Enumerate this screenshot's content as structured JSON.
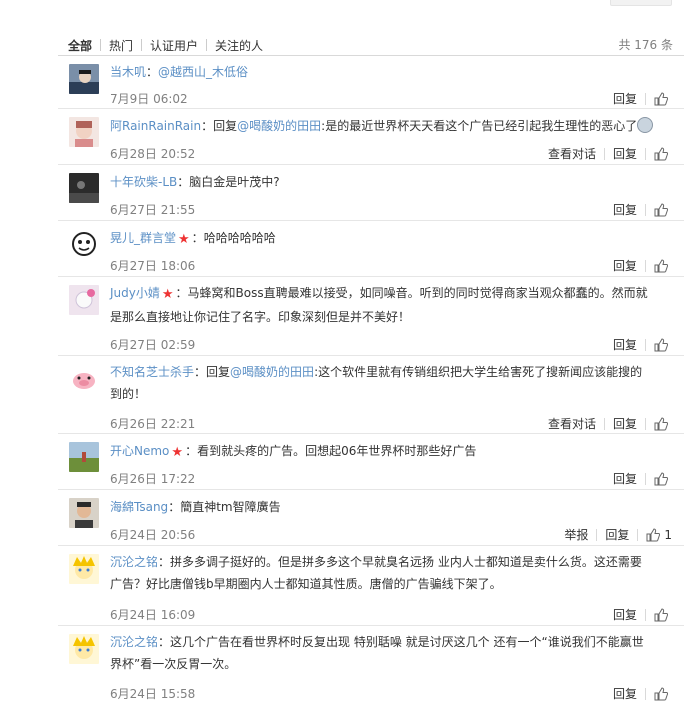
{
  "tabs": [
    "全部",
    "热门",
    "认证用户",
    "关注的人"
  ],
  "total": "共 176 条",
  "actions": {
    "reply": "回复",
    "view_conversation": "查看对话",
    "report": "举报"
  },
  "comments": [
    {
      "user": "当木叽",
      "sep": "：",
      "prefix": "",
      "mention": "@越西山_木低俗",
      "text": "",
      "time": "7月9日 06:02",
      "conversation": false,
      "report": false,
      "likes": ""
    },
    {
      "user": "阿RainRainRain",
      "sep": "：",
      "prefix": "回复",
      "mention": "@喝酸奶的田田",
      "text": ":是的最近世界杯天天看这个广告已经引起我生理性的恶心了",
      "time": "6月28日 20:52",
      "conversation": true,
      "report": false,
      "likes": ""
    },
    {
      "user": "十年砍柴-LB",
      "sep": "：",
      "prefix": "",
      "mention": "",
      "text": "脑白金是叶茂中?",
      "time": "6月27日 21:55",
      "conversation": false,
      "report": false,
      "likes": ""
    },
    {
      "user": "晃儿_群言堂",
      "sep": "：",
      "prefix": "",
      "mention": "",
      "text": "哈哈哈哈哈哈",
      "time": "6月27日 18:06",
      "conversation": false,
      "report": false,
      "likes": ""
    },
    {
      "user": "Judy小婧",
      "sep": "：",
      "prefix": "",
      "mention": "",
      "text": "马蜂窝和Boss直聘最难以接受，如同噪音。听到的同时觉得商家当观众都蠢的。然而就是那么直接地让你记住了名字。印象深刻但是并不美好！",
      "time": "6月27日 02:59",
      "conversation": false,
      "report": false,
      "likes": ""
    },
    {
      "user": "不知名芝士杀手",
      "sep": "：",
      "prefix": "回复",
      "mention": "@喝酸奶的田田",
      "text": ":这个软件里就有传销组织把大学生给害死了搜新闻应该能搜的到的！",
      "time": "6月26日 22:21",
      "conversation": true,
      "report": false,
      "likes": ""
    },
    {
      "user": "开心Nemo",
      "sep": "：",
      "prefix": "",
      "mention": "",
      "text": "看到就头疼的广告。回想起06年世界杯时那些好广告",
      "time": "6月26日 17:22",
      "conversation": false,
      "report": false,
      "likes": ""
    },
    {
      "user": "海綿Tsang",
      "sep": "：",
      "prefix": "",
      "mention": "",
      "text": "簡直神tm智障廣告",
      "time": "6月24日 20:56",
      "conversation": false,
      "report": true,
      "likes": "1"
    },
    {
      "user": "沉沦之铭",
      "sep": "：",
      "prefix": "",
      "mention": "",
      "text": "拼多多调子挺好的。但是拼多多这个早就臭名远扬 业内人士都知道是卖什么货。这还需要广告？好比唐僧钱b早期圈内人士都知道其性质。唐僧的广告骗线下架了。",
      "time": "6月24日 16:09",
      "conversation": false,
      "report": false,
      "likes": ""
    },
    {
      "user": "沉沦之铭",
      "sep": "：",
      "prefix": "",
      "mention": "",
      "text": "这几个广告在看世界杯时反复出现 特别聒噪 就是讨厌这几个 还有一个“谁说我们不能赢世界杯”看一次反胃一次。",
      "time": "6月24日 15:58",
      "conversation": false,
      "report": false,
      "likes": ""
    }
  ]
}
